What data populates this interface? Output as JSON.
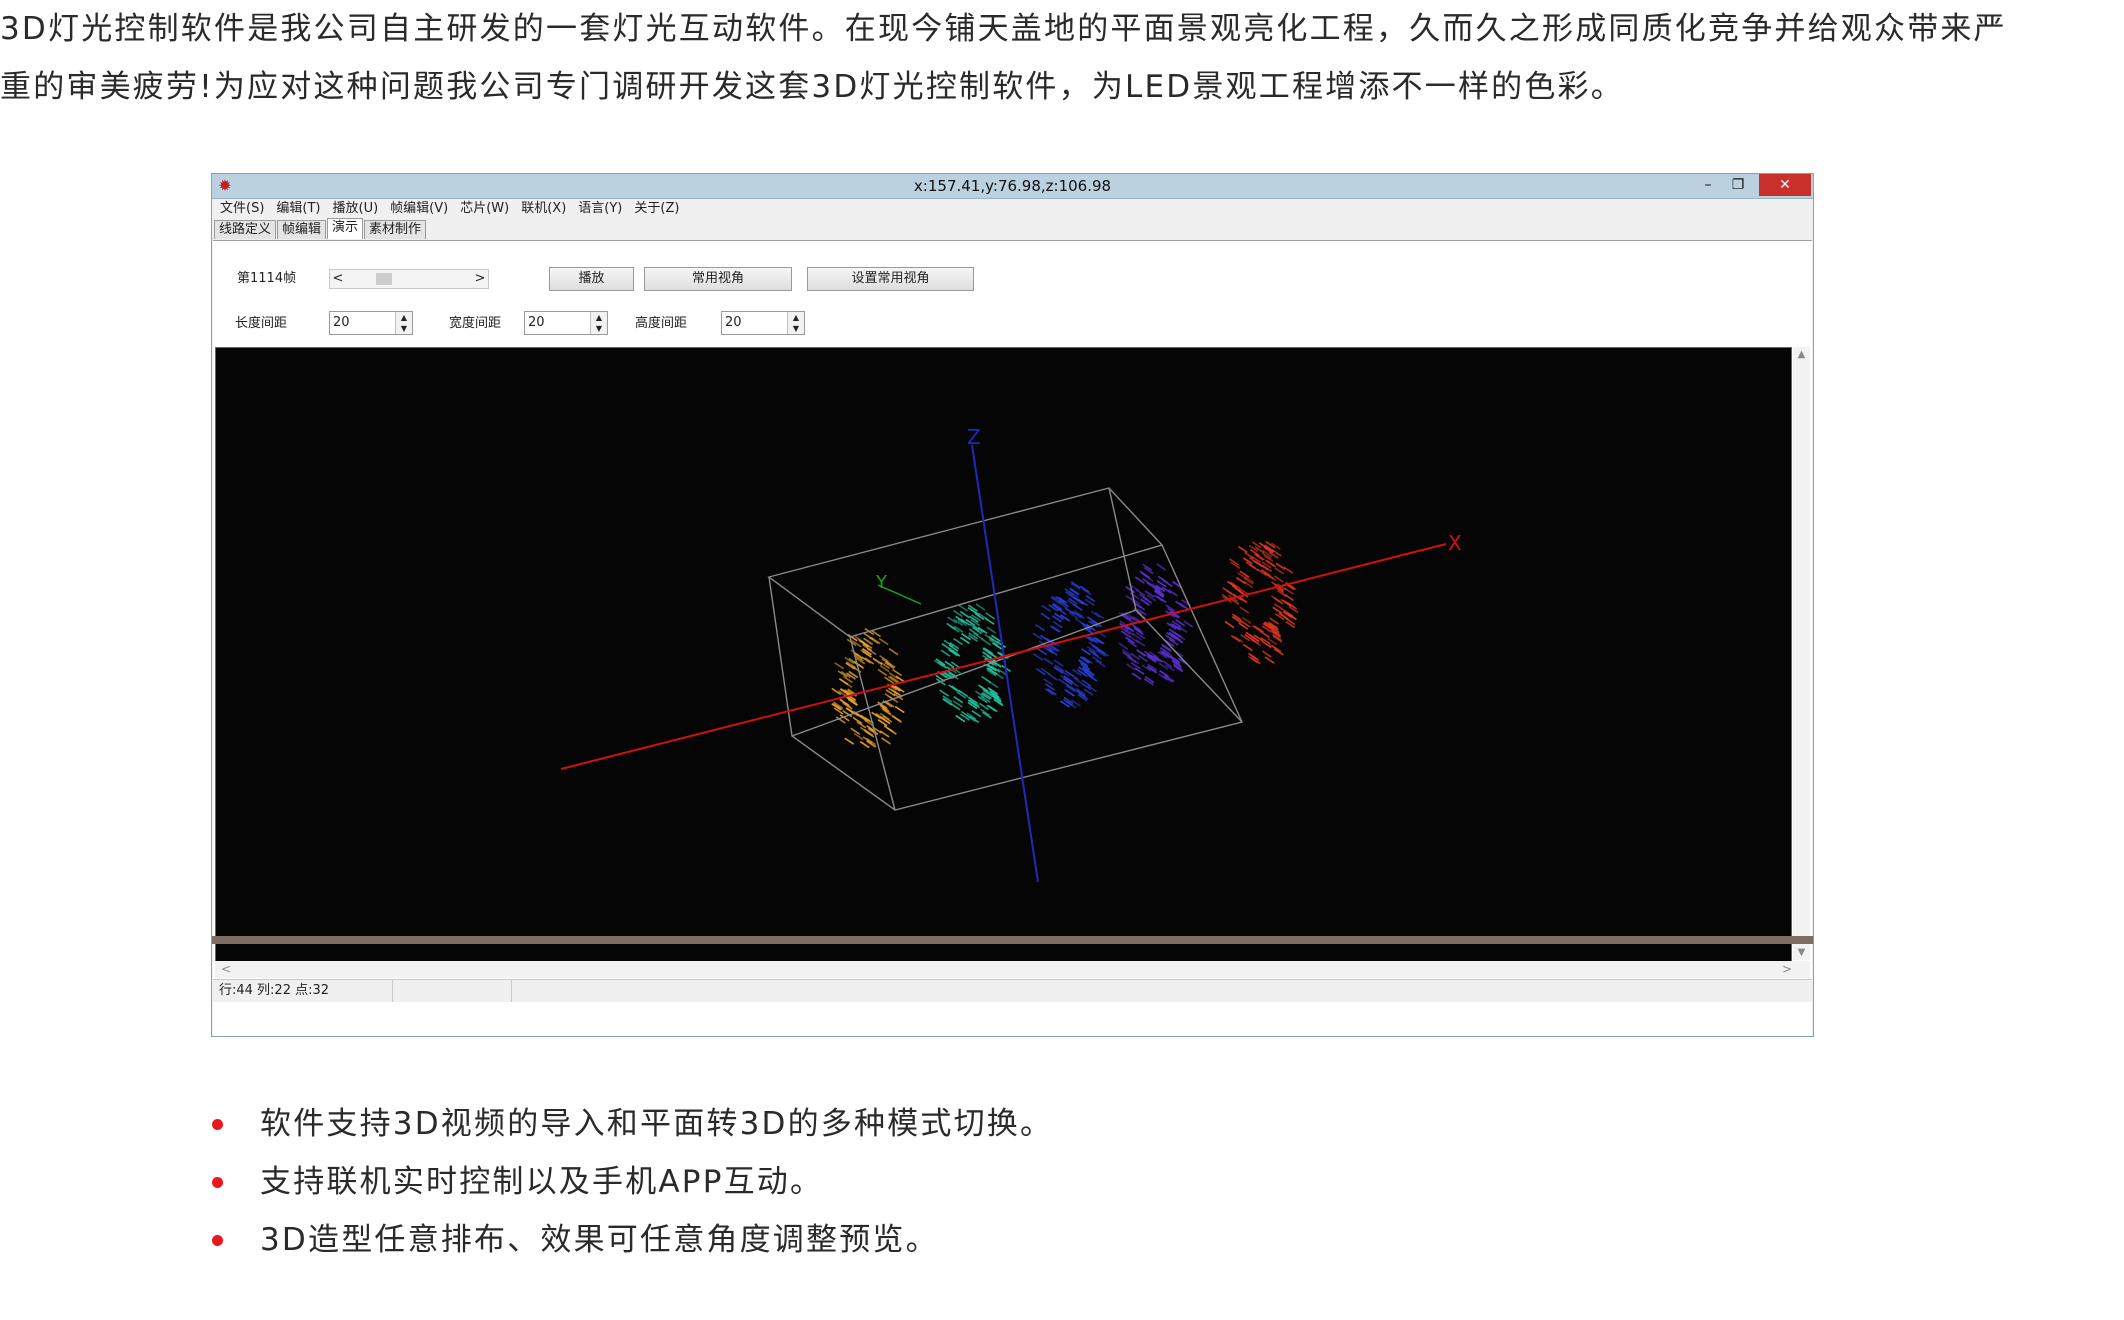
{
  "intro": {
    "line1": "3D灯光控制软件是我公司自主研发的一套灯光互动软件。在现今铺天盖地的平面景观亮化工程，久而久之形成同质化竞争并给观众带来严",
    "line2": "重的审美疲劳!为应对这种问题我公司专门调研开发这套3D灯光控制软件，为LED景观工程增添不一样的色彩。"
  },
  "window": {
    "title": "x:157.41,y:76.98,z:106.98",
    "min_glyph": "–",
    "max_glyph": "❐",
    "close_glyph": "✕",
    "app_icon_glyph": "✹",
    "menu": [
      "文件(S)",
      "编辑(T)",
      "播放(U)",
      "帧编辑(V)",
      "芯片(W)",
      "联机(X)",
      "语言(Y)",
      "关于(Z)"
    ],
    "tabs": [
      "线路定义",
      "帧编辑",
      "演示",
      "素材制作"
    ],
    "active_tab": "演示",
    "frame_label": "第1114帧",
    "frame_prev": "<",
    "frame_next": ">",
    "buttons": {
      "play": "播放",
      "common_view": "常用视角",
      "set_common_view": "设置常用视角"
    },
    "spacing": [
      {
        "label": "长度间距",
        "value": "20"
      },
      {
        "label": "宽度间距",
        "value": "20"
      },
      {
        "label": "高度间距",
        "value": "20"
      }
    ],
    "viewport": {
      "axis_x_label": "X",
      "axis_y_label": "Y",
      "axis_z_label": "Z",
      "axis_x_color": "#d01010",
      "axis_y_color": "#18a020",
      "axis_z_color": "#1f2ab8",
      "ring_colors": [
        "#e8a22a",
        "#24c4a0",
        "#2b3fd8",
        "#5a30d0",
        "#e03822"
      ]
    },
    "scroll_up": "▲",
    "scroll_down": "▼",
    "scroll_left": "<",
    "scroll_right": ">",
    "status": "行:44 列:22 点:32"
  },
  "bullets": [
    "软件支持3D视频的导入和平面转3D的多种模式切换。",
    "支持联机实时控制以及手机APP互动。",
    "3D造型任意排布、效果可任意角度调整预览。"
  ],
  "bullet_color": "#e8191b"
}
